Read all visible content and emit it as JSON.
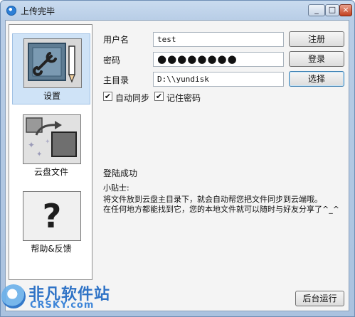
{
  "window": {
    "title": "上传完毕",
    "controls": {
      "minimize": "_",
      "maximize": "□",
      "close": "×"
    }
  },
  "sidebar": {
    "items": [
      {
        "label": "设置",
        "icon": "settings-tools-icon",
        "selected": true
      },
      {
        "label": "云盘文件",
        "icon": "cloud-files-icon",
        "selected": false
      },
      {
        "label": "帮助&反馈",
        "icon": "help-question-icon",
        "selected": false
      }
    ]
  },
  "form": {
    "username_label": "用户名",
    "username_value": "test",
    "password_label": "密码",
    "password_value": "●●●●●●●●",
    "homedir_label": "主目录",
    "homedir_value": "D:\\\\yundisk",
    "register_button": "注册",
    "login_button": "登录",
    "choose_button": "选择",
    "auto_sync_label": "自动同步",
    "auto_sync_checked": true,
    "remember_label": "记住密码",
    "remember_checked": true
  },
  "status": {
    "message": "登陆成功"
  },
  "tips": {
    "heading": "小贴士:",
    "line1": "将文件放到云盘主目录下，就会自动帮您把文件同步到云端哦。",
    "line2": "在任何地方都能找到它，您的本地文件就可以随时与好友分享了^_^"
  },
  "footer": {
    "background_run_button": "后台运行"
  },
  "watermark": {
    "main": "非凡软件站",
    "sub": "CRSKY.com"
  },
  "colors": {
    "selected_bg": "#cfe3f7",
    "frame": "#aac2df",
    "watermark": "#1a66c2"
  }
}
